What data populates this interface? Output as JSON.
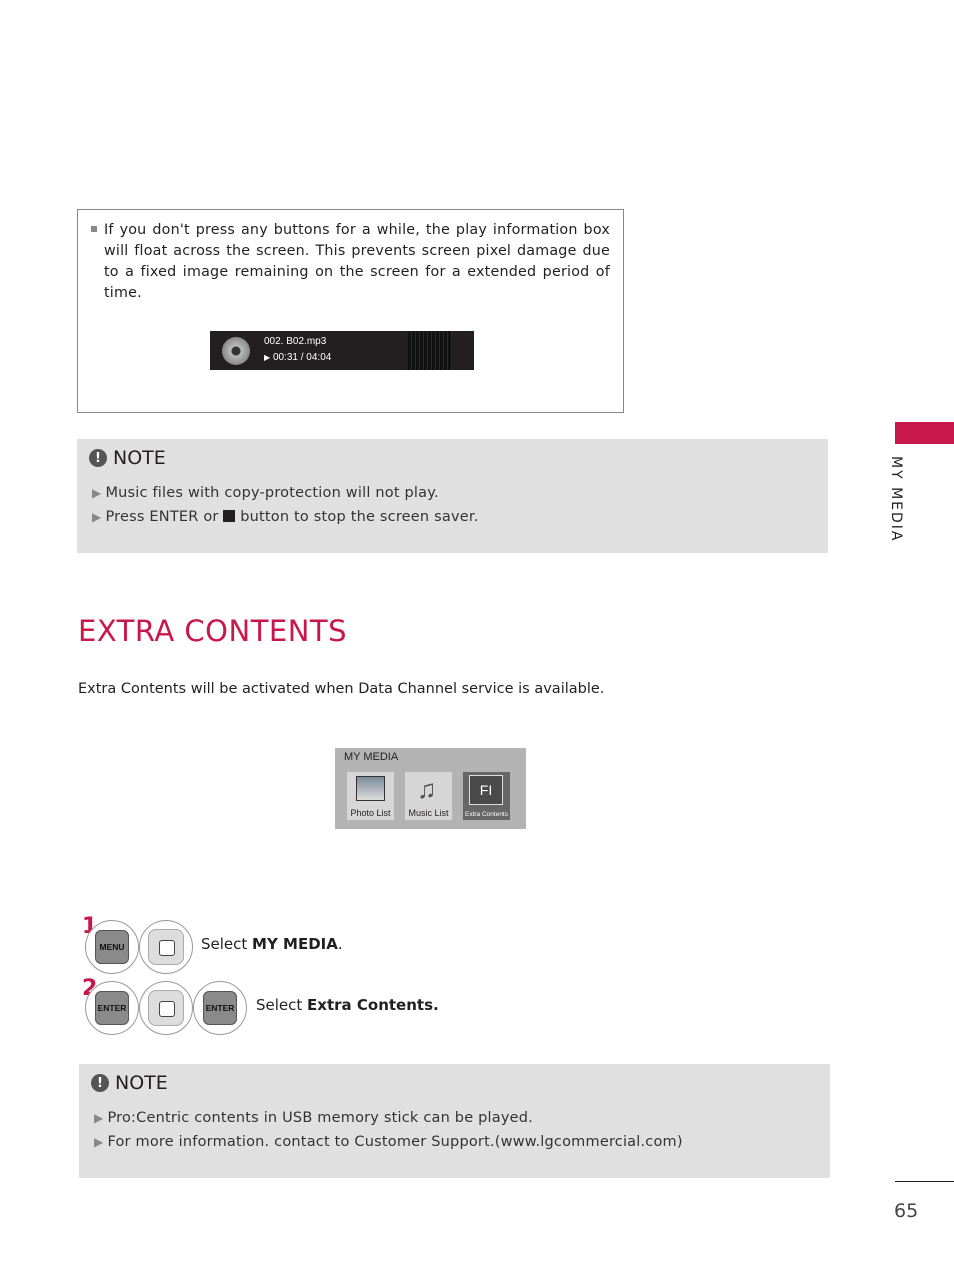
{
  "info_box": {
    "text": "If you don't press any buttons for a while, the play information box will float across the screen. This prevents screen pixel damage due to a fixed image remaining on the screen for a extended period of time.",
    "player": {
      "filename": "002. B02.mp3",
      "time": "00:31 / 04:04",
      "play_icon": "▶"
    }
  },
  "note1": {
    "title": "NOTE",
    "items": [
      "Music files with copy-protection will not play.",
      "Press ENTER or",
      "button to stop the screen saver."
    ]
  },
  "section": {
    "heading": "EXTRA CONTENTS",
    "intro": "Extra Contents will be activated when Data Channel service is available."
  },
  "menu": {
    "title": "MY MEDIA",
    "tiles": [
      "Photo List",
      "Music List",
      "Extra Contents"
    ],
    "extra_icon_text": "FI"
  },
  "steps": [
    {
      "number": "1",
      "buttons": [
        "MENU"
      ],
      "text_prefix": "Select ",
      "text_bold": "MY MEDIA",
      "text_suffix": "."
    },
    {
      "number": "2",
      "buttons": [
        "ENTER",
        "ENTER"
      ],
      "text_prefix": "Select ",
      "text_bold": "Extra Contents.",
      "text_suffix": ""
    }
  ],
  "note2": {
    "title": "NOTE",
    "items": [
      "Pro:Centric contents in USB memory stick can be played.",
      "For more information. contact to Customer Support.(www.lgcommercial.com)"
    ]
  },
  "side_tab": {
    "label": "MY MEDIA",
    "color": "#c8174b"
  },
  "page_number": "65"
}
